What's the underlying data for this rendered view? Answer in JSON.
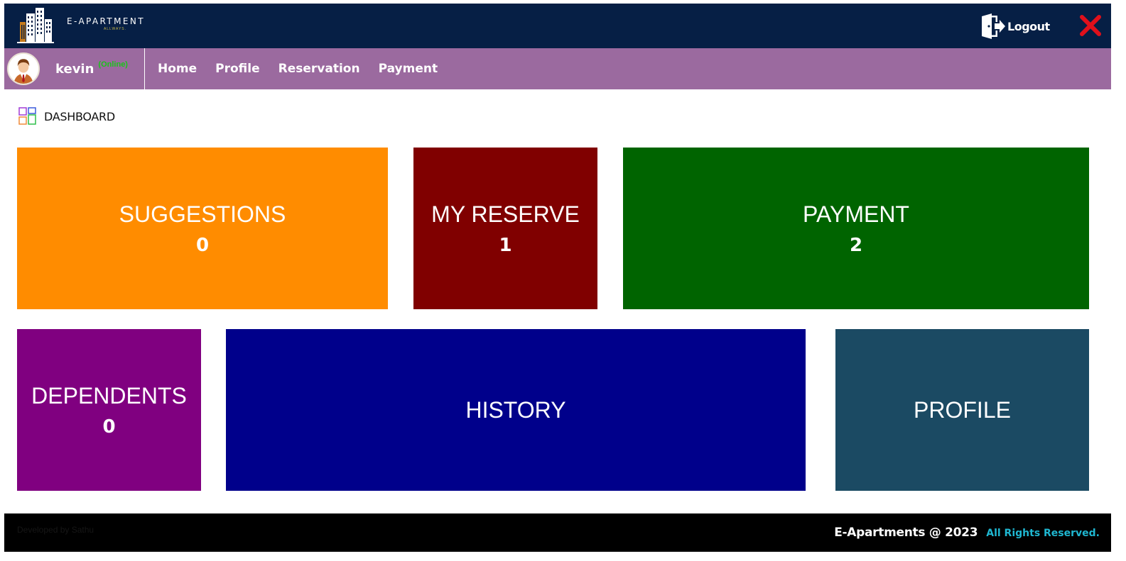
{
  "brand": {
    "name": "E-APARTMENT",
    "tagline": "ALLWAYS."
  },
  "header": {
    "logout_label": "Logout",
    "logout_icon": "logout-door-icon",
    "close_icon": "close-x-icon"
  },
  "user": {
    "name": "kevin",
    "status": "(Online)",
    "avatar_icon": "user-avatar-icon"
  },
  "nav": {
    "items": [
      {
        "label": "Home"
      },
      {
        "label": "Profile"
      },
      {
        "label": "Reservation"
      },
      {
        "label": "Payment"
      }
    ]
  },
  "dashboard": {
    "title": "DASHBOARD",
    "icon": "dashboard-grid-icon",
    "tiles": [
      {
        "label": "SUGGESTIONS",
        "count": "0",
        "color": "#ff8c00"
      },
      {
        "label": "MY RESERVE",
        "count": "1",
        "color": "#800000"
      },
      {
        "label": "PAYMENT",
        "count": "2",
        "color": "#006400"
      },
      {
        "label": "DEPENDENTS",
        "count": "0",
        "color": "#800080"
      },
      {
        "label": "HISTORY",
        "count": "",
        "color": "#00008b"
      },
      {
        "label": "PROFILE",
        "count": "",
        "color": "#1b4a63"
      }
    ]
  },
  "footer": {
    "developer_credit": "Developed by Sathu",
    "copyright": "E-Apartments @ 2023",
    "rights": "All Rights Reserved."
  },
  "colors": {
    "header_bg": "#061f45",
    "nav_bg": "#9b6a9f",
    "online": "#19c419",
    "footer_bg": "#000000",
    "rights_accent": "#1fb7d1",
    "close_red": "#e0101b"
  }
}
